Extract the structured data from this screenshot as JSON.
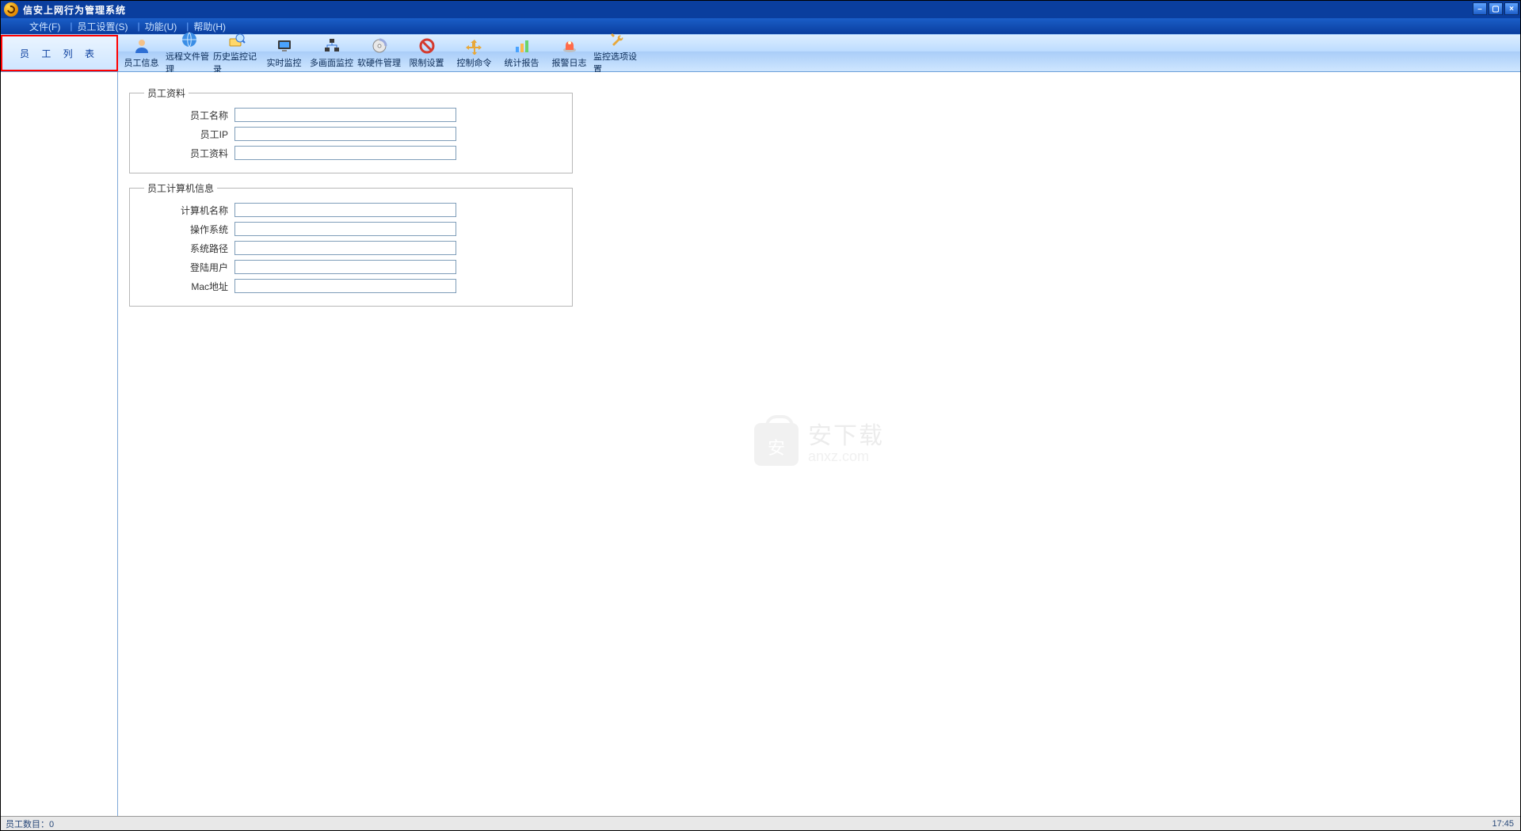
{
  "title": "信安上网行为管理系统",
  "menus": {
    "file": "文件(F)",
    "employee_settings": "员工设置(S)",
    "features": "功能(U)",
    "help": "帮助(H)"
  },
  "sidebar_header": "员 工 列 表",
  "toolbar": [
    {
      "id": "employee-info",
      "label": "员工信息"
    },
    {
      "id": "remote-file-mgmt",
      "label": "远程文件管理"
    },
    {
      "id": "history-monitor",
      "label": "历史监控记录"
    },
    {
      "id": "realtime-monitor",
      "label": "实时监控"
    },
    {
      "id": "multi-screen",
      "label": "多画面监控"
    },
    {
      "id": "hw-sw-mgmt",
      "label": "软硬件管理"
    },
    {
      "id": "limit-settings",
      "label": "限制设置"
    },
    {
      "id": "control-cmd",
      "label": "控制命令"
    },
    {
      "id": "stats-report",
      "label": "统计报告"
    },
    {
      "id": "alarm-log",
      "label": "报警日志"
    },
    {
      "id": "monitor-options",
      "label": "监控选项设置"
    }
  ],
  "groups": {
    "employee_profile": {
      "legend": "员工资料",
      "fields": {
        "name": {
          "label": "员工名称",
          "value": ""
        },
        "ip": {
          "label": "员工IP",
          "value": ""
        },
        "profile": {
          "label": "员工资料",
          "value": ""
        }
      }
    },
    "computer_info": {
      "legend": "员工计算机信息",
      "fields": {
        "computer_name": {
          "label": "计算机名称",
          "value": ""
        },
        "os": {
          "label": "操作系统",
          "value": ""
        },
        "system_path": {
          "label": "系统路径",
          "value": ""
        },
        "login_user": {
          "label": "登陆用户",
          "value": ""
        },
        "mac": {
          "label": "Mac地址",
          "value": ""
        }
      }
    }
  },
  "watermark": {
    "cn": "安下载",
    "en": "anxz.com"
  },
  "statusbar": {
    "left": "员工数目：0",
    "right": "17:45"
  }
}
